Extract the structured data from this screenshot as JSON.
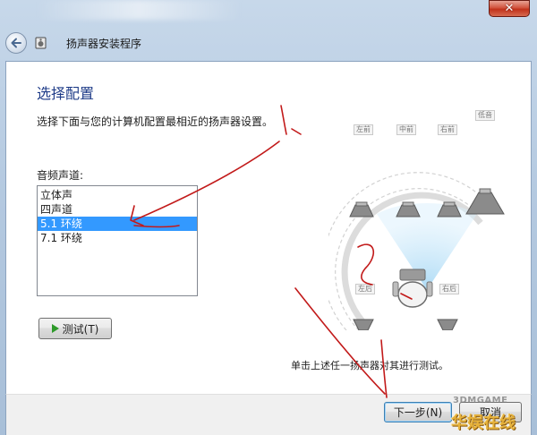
{
  "window": {
    "title": "扬声器安装程序",
    "close_glyph": "✕"
  },
  "page": {
    "heading": "选择配置",
    "description": "选择下面与您的计算机配置最相近的扬声器设置。",
    "channels_label": "音频声道:",
    "hint": "单击上述任一扬声器对其进行测试。"
  },
  "channels": [
    {
      "label": "立体声",
      "selected": false
    },
    {
      "label": "四声道",
      "selected": false
    },
    {
      "label": "5.1 环绕",
      "selected": true
    },
    {
      "label": "7.1 环绕",
      "selected": false
    }
  ],
  "buttons": {
    "test": "测试(T)",
    "next": "下一步(N)",
    "cancel": "取消"
  },
  "speakers": {
    "front_left": "左前",
    "center": "中前",
    "front_right": "右前",
    "subwoofer": "低音",
    "rear_left": "左后",
    "rear_right": "右后"
  },
  "watermark": {
    "top": "3DMGAME",
    "bottom": "华娱在线"
  },
  "colors": {
    "accent": "#3399ff",
    "heading": "#1f3c88",
    "annotation": "#c21a1a",
    "play": "#2e9a2a"
  }
}
